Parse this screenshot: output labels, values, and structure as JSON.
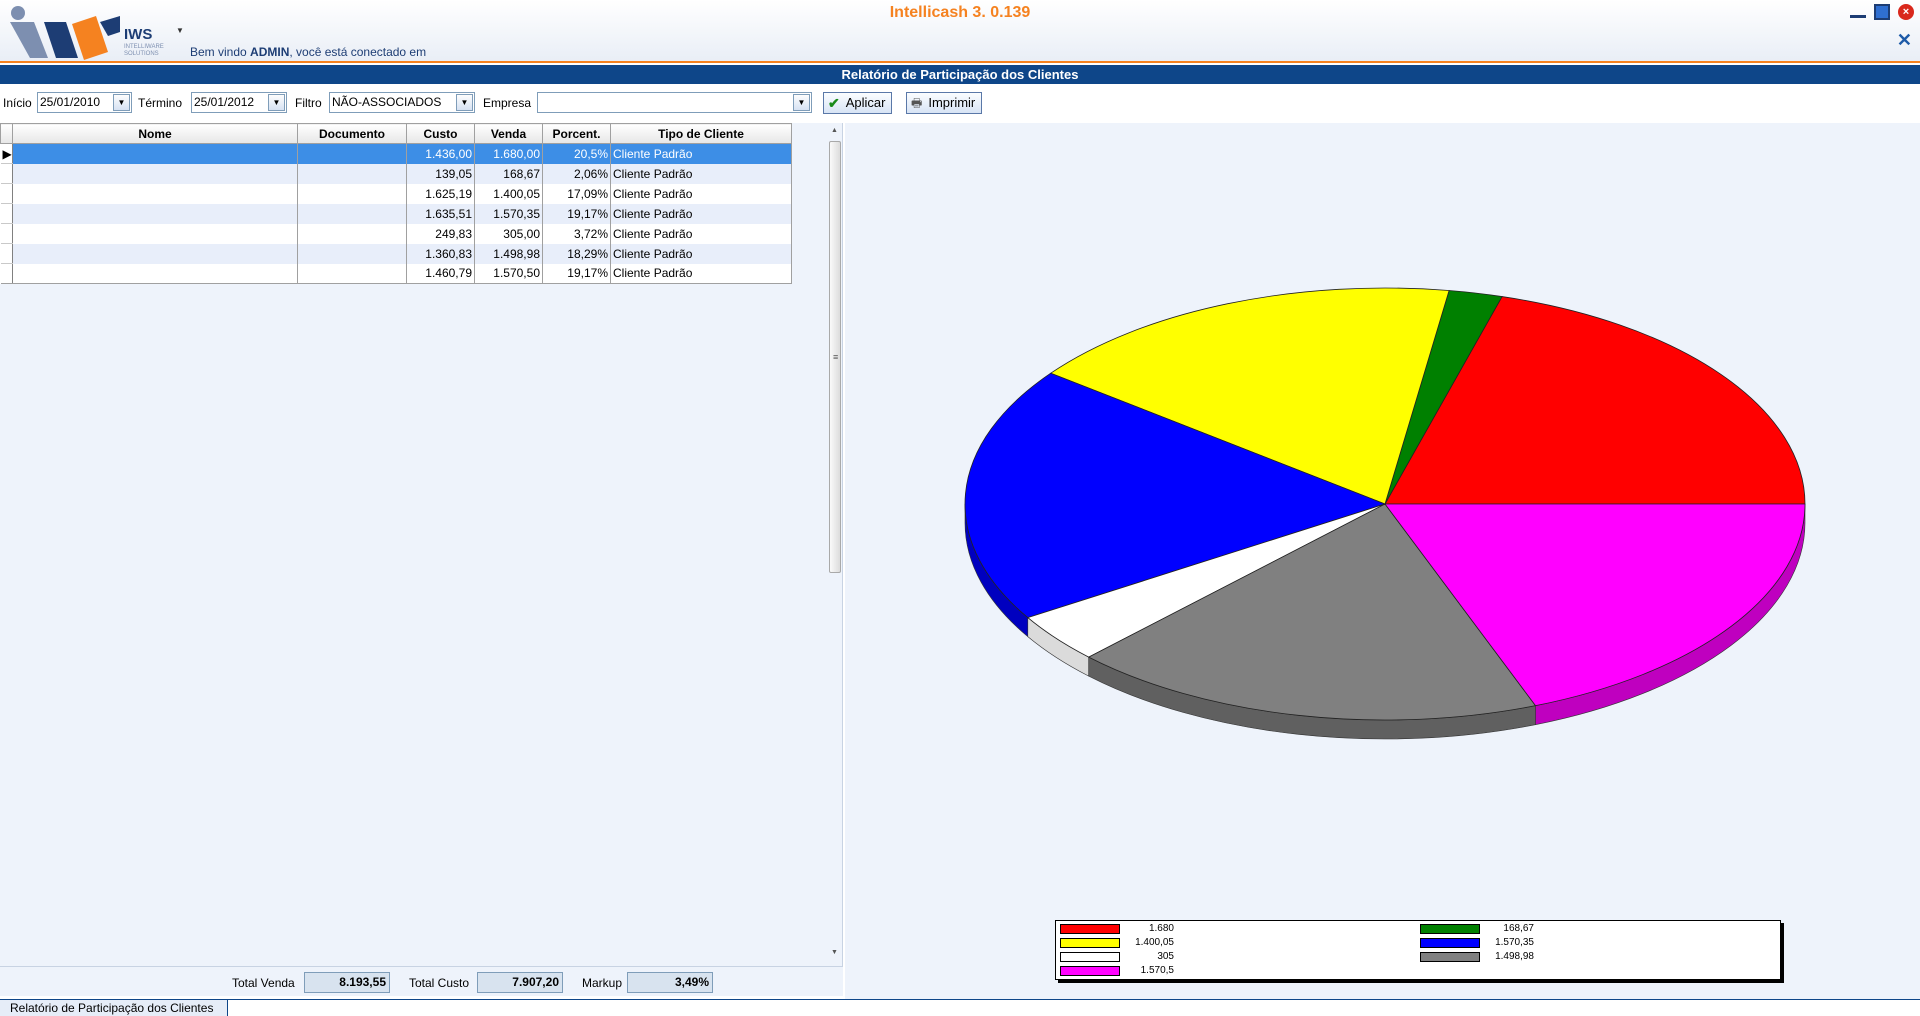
{
  "app": {
    "title": "Intellicash 3. 0.139",
    "logo_text": "IWS",
    "logo_sub": "INTELLIWARE SOLUTIONS",
    "welcome_prefix": "Bem vindo ",
    "user": "ADMIN",
    "welcome_suffix": ", você está conectado em"
  },
  "report_title": "Relatório de Participação dos Clientes",
  "filters": {
    "inicio_label": "Início",
    "inicio_value": "25/01/2010",
    "termino_label": "Término",
    "termino_value": "25/01/2012",
    "filtro_label": "Filtro",
    "filtro_value": "NÃO-ASSOCIADOS",
    "empresa_label": "Empresa",
    "empresa_value": "",
    "aplicar_label": "Aplicar",
    "imprimir_label": "Imprimir"
  },
  "grid": {
    "columns": [
      "Nome",
      "Documento",
      "Custo",
      "Venda",
      "Porcent.",
      "Tipo de Cliente"
    ],
    "rows": [
      {
        "nome": "",
        "documento": "",
        "custo": "1.436,00",
        "venda": "1.680,00",
        "porcent": "20,5%",
        "tipo": "Cliente Padrão"
      },
      {
        "nome": "",
        "documento": "",
        "custo": "139,05",
        "venda": "168,67",
        "porcent": "2,06%",
        "tipo": "Cliente Padrão"
      },
      {
        "nome": "",
        "documento": "",
        "custo": "1.625,19",
        "venda": "1.400,05",
        "porcent": "17,09%",
        "tipo": "Cliente Padrão"
      },
      {
        "nome": "",
        "documento": "",
        "custo": "1.635,51",
        "venda": "1.570,35",
        "porcent": "19,17%",
        "tipo": "Cliente Padrão"
      },
      {
        "nome": "",
        "documento": "",
        "custo": "249,83",
        "venda": "305,00",
        "porcent": "3,72%",
        "tipo": "Cliente Padrão"
      },
      {
        "nome": "",
        "documento": "",
        "custo": "1.360,83",
        "venda": "1.498,98",
        "porcent": "18,29%",
        "tipo": "Cliente Padrão"
      },
      {
        "nome": "",
        "documento": "",
        "custo": "1.460,79",
        "venda": "1.570,50",
        "porcent": "19,17%",
        "tipo": "Cliente Padrão"
      }
    ]
  },
  "totals": {
    "venda_label": "Total Venda",
    "venda_value": "8.193,55",
    "custo_label": "Total Custo",
    "custo_value": "7.907,20",
    "markup_label": "Markup",
    "markup_value": "3,49%"
  },
  "tab_label": "Relatório de Participação dos Clientes",
  "chart_data": {
    "type": "pie",
    "title": "",
    "slices": [
      {
        "label": "1.680",
        "value": 1680,
        "color": "#ff0000"
      },
      {
        "label": "168,67",
        "value": 168.67,
        "color": "#008000"
      },
      {
        "label": "1.400,05",
        "value": 1400.05,
        "color": "#ffff00"
      },
      {
        "label": "1.570,35",
        "value": 1570.35,
        "color": "#0000ff"
      },
      {
        "label": "305",
        "value": 305,
        "color": "#ffffff"
      },
      {
        "label": "1.498,98",
        "value": 1498.98,
        "color": "#808080"
      },
      {
        "label": "1.570,5",
        "value": 1570.5,
        "color": "#ff00ff"
      }
    ],
    "legend_placement": "bottom"
  }
}
